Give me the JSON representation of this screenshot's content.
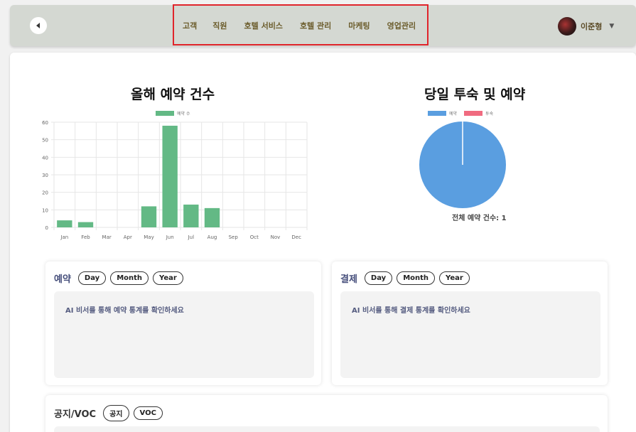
{
  "header": {
    "nav": [
      "고객",
      "직원",
      "호텔 서비스",
      "호텔 관리",
      "마케팅",
      "영업관리"
    ],
    "user_name": "이준형"
  },
  "colors": {
    "header_bg": "#d4d8d2",
    "bar": "#63b985",
    "pie_reservation": "#5a9ee0",
    "pie_checkin": "#f06b80",
    "highlight": "#e0242b"
  },
  "charts": {
    "yearly": {
      "title": "올해 예약 건수",
      "legend": "예약 수"
    },
    "daily": {
      "title": "당일 투숙 및 예약",
      "legend": [
        "예약",
        "투숙"
      ],
      "total_label": "전체 예약 건수: 1"
    }
  },
  "chart_data": [
    {
      "type": "bar",
      "title": "올해 예약 건수",
      "categories": [
        "Jan",
        "Feb",
        "Mar",
        "Apr",
        "May",
        "Jun",
        "Jul",
        "Aug",
        "Sep",
        "Oct",
        "Nov",
        "Dec"
      ],
      "series": [
        {
          "name": "예약 수",
          "values": [
            4,
            3,
            0,
            0,
            12,
            58,
            13,
            11,
            0,
            0,
            0,
            0
          ]
        }
      ],
      "yticks": [
        0,
        10,
        20,
        30,
        40,
        50,
        60
      ],
      "ylim": [
        0,
        60
      ],
      "grid": true,
      "legend": "top"
    },
    {
      "type": "pie",
      "title": "당일 투숙 및 예약",
      "categories": [
        "예약",
        "투숙"
      ],
      "values": [
        1,
        0
      ],
      "legend": "top"
    }
  ],
  "reservation_card": {
    "title": "예약",
    "buttons": [
      "Day",
      "Month",
      "Year"
    ],
    "message": "AI 비서를 통해 예약 통계를 확인하세요"
  },
  "payment_card": {
    "title": "결제",
    "buttons": [
      "Day",
      "Month",
      "Year"
    ],
    "message": "AI 비서를 통해 결제 통계를 확인하세요"
  },
  "notice_card": {
    "title": "공지/VOC",
    "buttons": [
      "공지",
      "VOC"
    ]
  }
}
